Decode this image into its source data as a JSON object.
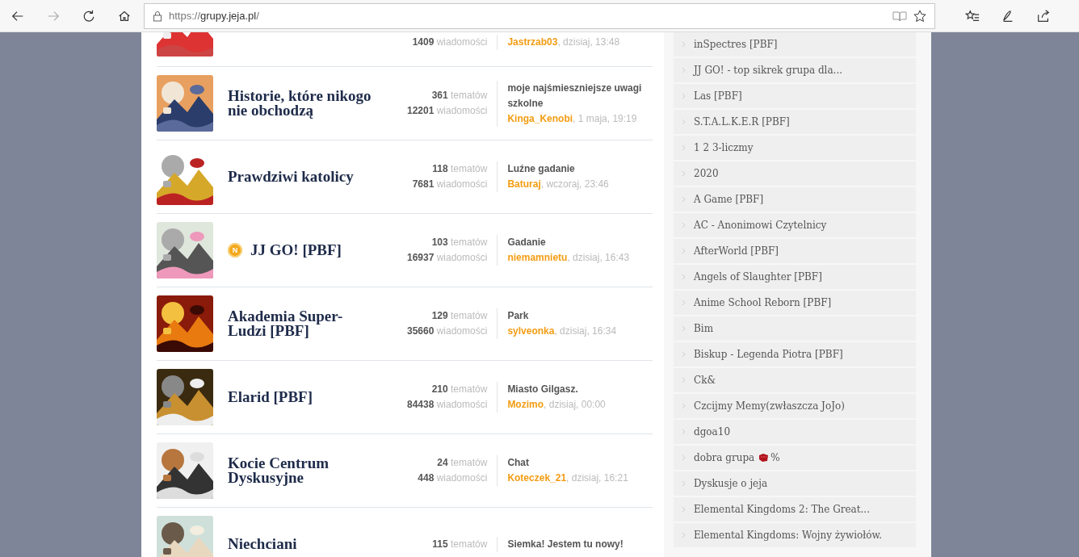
{
  "browser": {
    "url_prefix": "https://",
    "url_host": "grupy.jeja.pl",
    "url_path": "/"
  },
  "groups": [
    {
      "messages": "1409",
      "messages_label": "wiadomości",
      "last_user": "Jastrzab03",
      "last_time": ", dzisiaj, 13:48"
    },
    {
      "title": "Historie, które nikogo nie obchodzą",
      "topics": "361",
      "topics_label": "tematów",
      "messages": "12201",
      "messages_label": "wiadomości",
      "last_post": "moje najśmieszniejsze uwagi szkolne",
      "last_user": "Kinga_Kenobi",
      "last_time": ", 1 maja, 19:19"
    },
    {
      "title": "Prawdziwi katolicy",
      "topics": "118",
      "topics_label": "tematów",
      "messages": "7681",
      "messages_label": "wiadomości",
      "last_post": "Luźne gadanie",
      "last_user": "Baturaj",
      "last_time": ", wczoraj, 23:46"
    },
    {
      "title": "JJ GO! [PBF]",
      "badge": "N",
      "topics": "103",
      "topics_label": "tematów",
      "messages": "16937",
      "messages_label": "wiadomości",
      "last_post": "Gadanie",
      "last_user": "niemamnietu",
      "last_time": ", dzisiaj, 16:43"
    },
    {
      "title": "Akademia Super-Ludzi [PBF]",
      "topics": "129",
      "topics_label": "tematów",
      "messages": "35660",
      "messages_label": "wiadomości",
      "last_post": "Park",
      "last_user": "sylveonka",
      "last_time": ", dzisiaj, 16:34"
    },
    {
      "title": "Elarid [PBF]",
      "topics": "210",
      "topics_label": "tematów",
      "messages": "84438",
      "messages_label": "wiadomości",
      "last_post": "Miasto Gilgasz.",
      "last_user": "Mozimo",
      "last_time": ", dzisiaj, 00:00"
    },
    {
      "title": "Kocie Centrum Dyskusyjne",
      "topics": "24",
      "topics_label": "tematów",
      "messages": "448",
      "messages_label": "wiadomości",
      "last_post": "Chat",
      "last_user": "Koteczek_21",
      "last_time": ", dzisiaj, 16:21"
    },
    {
      "title": "Niechciani",
      "topics": "115",
      "topics_label": "tematów",
      "last_post": "Siemka! Jestem tu nowy!"
    }
  ],
  "sidebar": {
    "items": [
      {
        "label": "inSpectres [PBF]"
      },
      {
        "label": "JJ GO! - top sikrek grupa dla..."
      },
      {
        "label": "Las [PBF]"
      },
      {
        "label": "S.T.A.L.K.E.R [PBF]"
      },
      {
        "label": "1 2 3-liczmy"
      },
      {
        "label": "2020"
      },
      {
        "label": "A Game [PBF]"
      },
      {
        "label": "AC - Anonimowi Czytelnicy"
      },
      {
        "label": "AfterWorld [PBF]"
      },
      {
        "label": "Angels of Slaughter [PBF]"
      },
      {
        "label": "Anime School Reborn [PBF]"
      },
      {
        "label": "Bim"
      },
      {
        "label": "Biskup - Legenda Piotra [PBF]"
      },
      {
        "label": "Ck&"
      },
      {
        "label": "Czcijmy Memy(zwłaszcza JoJo)"
      },
      {
        "label": "dgoa10"
      },
      {
        "label": "dobra grupa",
        "emoji_suffix": "%"
      },
      {
        "label": "Dyskusje o jeja"
      },
      {
        "label": "Elemental Kingdoms 2: The Great..."
      },
      {
        "label": "Elemental Kingdoms: Wojny żywiołów."
      }
    ]
  }
}
